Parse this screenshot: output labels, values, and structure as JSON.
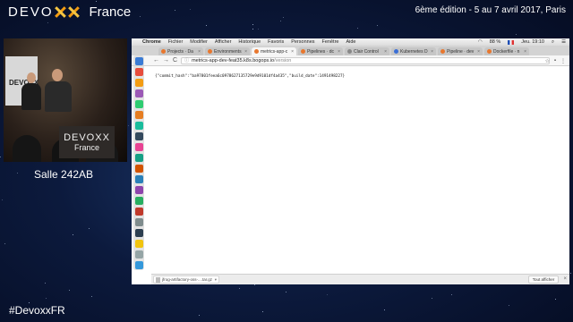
{
  "header": {
    "brand_devo": "DEVO",
    "brand_x": "XX",
    "brand_france": "France",
    "edition": "6ème édition - 5 au 7 avril 2017, Paris"
  },
  "video": {
    "banner_title": "DEVOXX",
    "banner_sub": "France",
    "mini_logo": "DEVOXX",
    "room": "Salle 242AB"
  },
  "footer": {
    "hashtag": "#DevoxxFR"
  },
  "menubar": {
    "apple_icon": "apple-icon",
    "items": [
      "Chrome",
      "Fichier",
      "Modifier",
      "Afficher",
      "Historique",
      "Favoris",
      "Personnes",
      "Fenêtre",
      "Aide"
    ],
    "battery": "88 %",
    "clock": "Jeu. 19:10"
  },
  "tabs": [
    {
      "label": "Projects · Da",
      "color": "#e8772e"
    },
    {
      "label": "Environments",
      "color": "#e8772e"
    },
    {
      "label": "metrics-app-c",
      "color": "#e8772e",
      "active": true
    },
    {
      "label": "Pipelines · dc",
      "color": "#e8772e"
    },
    {
      "label": "Clair Control",
      "color": "#888888"
    },
    {
      "label": "Kubernetes D",
      "color": "#3b6fd6"
    },
    {
      "label": "Pipeline · dev",
      "color": "#e8772e"
    },
    {
      "label": "Dockerfile · n",
      "color": "#e8772e"
    }
  ],
  "toolbar": {
    "back": "←",
    "forward": "→",
    "reload": "C",
    "url_host": "metrics-app-dev-feat35.k8s.bogops.io",
    "url_path": "/version"
  },
  "page": {
    "json_text": "{\"commit_hash\":\"ba97801feea6c0978627135729e9d9101df4a435\",\"build_date\":1491498227}"
  },
  "downloads": {
    "file_label": "jfrog-artifactory-oss-....tar.gz",
    "show_all": "Tout afficher"
  },
  "colors": {
    "accent_orange": "#f39c12",
    "background_navy": "#0c1a3d"
  }
}
